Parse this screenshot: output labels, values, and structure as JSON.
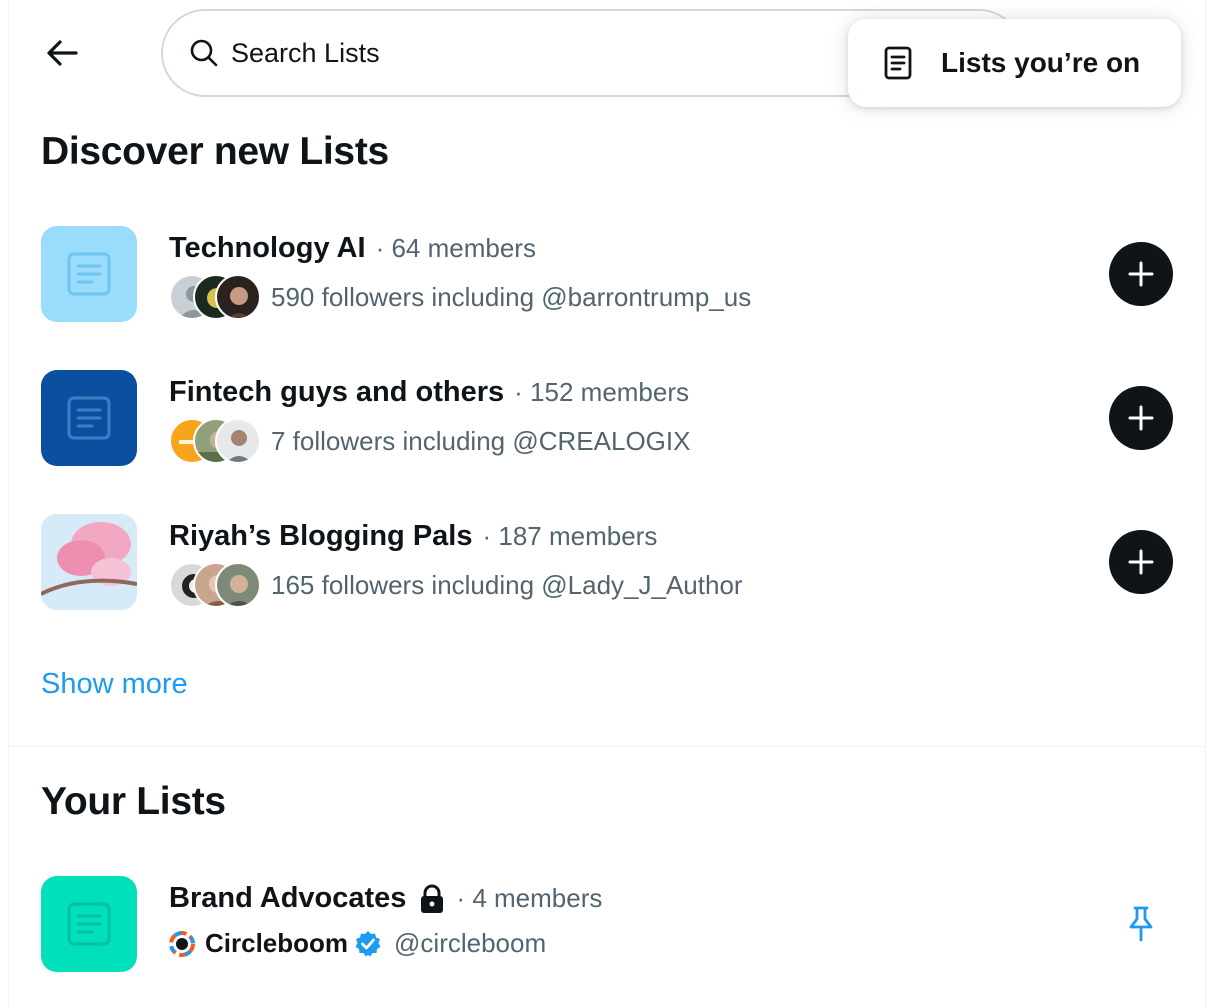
{
  "header": {
    "search_placeholder": "Search Lists",
    "popover_label": "Lists you’re on"
  },
  "discover": {
    "title": "Discover new Lists",
    "show_more": "Show more",
    "items": [
      {
        "name": "Technology AI",
        "members": "· 64 members",
        "followers": "590 followers including @barrontrump_us",
        "icon_color": "#99dcfb"
      },
      {
        "name": "Fintech guys and others",
        "members": "· 152 members",
        "followers": "7 followers including @CREALOGIX",
        "icon_color": "#0b4fa0"
      },
      {
        "name": "Riyah’s Blogging Pals",
        "members": "· 187 members",
        "followers": "165 followers including @Lady_J_Author",
        "icon_color": "#f3c1d6"
      }
    ]
  },
  "your_lists": {
    "title": "Your Lists",
    "items": [
      {
        "name": "Brand Advocates",
        "members": "· 4 members",
        "owner_name": "Circleboom",
        "owner_handle": "@circleboom",
        "icon_color": "#00e0bb"
      }
    ]
  },
  "colors": {
    "accent": "#1d9bf0",
    "text": "#0f1419",
    "secondary": "#536471"
  }
}
